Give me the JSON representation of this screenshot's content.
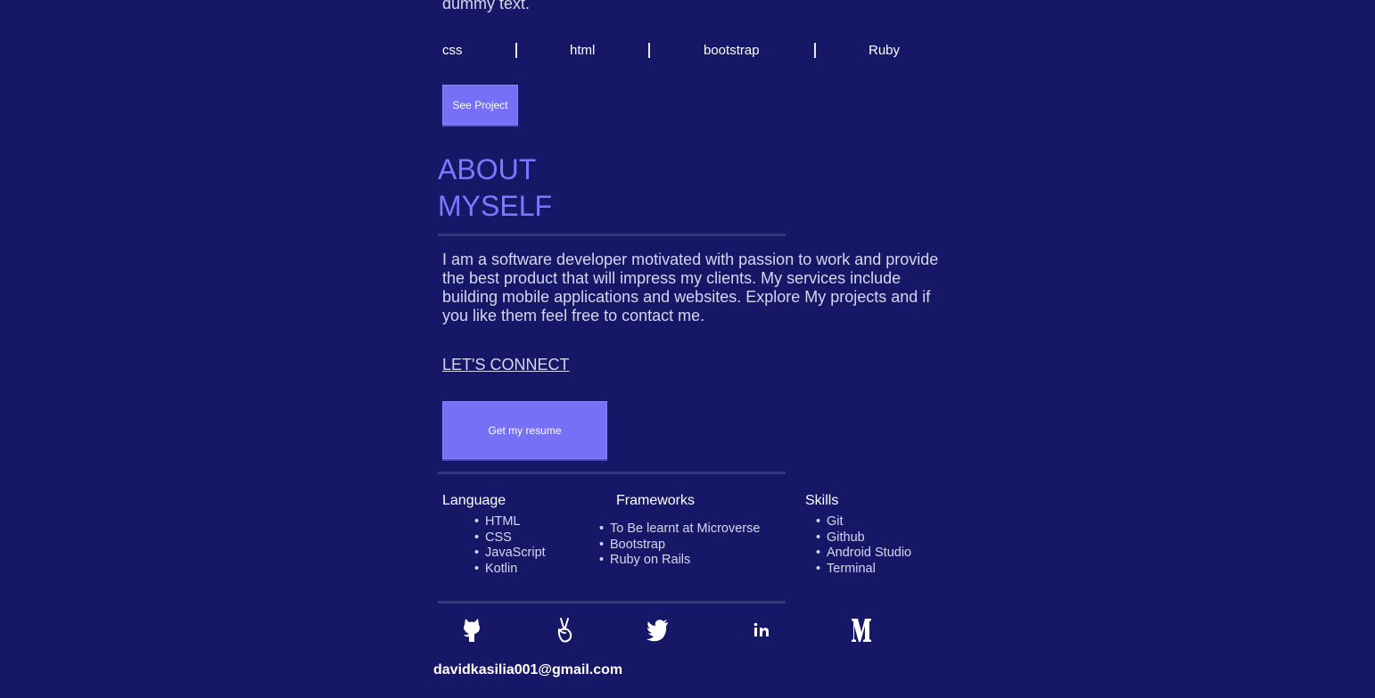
{
  "intro_tail": "dummy text.",
  "tags": [
    "css",
    "html",
    "bootstrap",
    "Ruby"
  ],
  "see_project_label": "See Project",
  "about": {
    "title_line1": "ABOUT",
    "title_line2": "MYSELF",
    "paragraph": "I am a software developer motivated with passion to work and provide the best product that will impress my clients. My services include building mobile applications and websites. Explore My projects and if you like them feel free to contact me."
  },
  "connect_label": "LET'S CONNECT",
  "resume_label": "Get my resume",
  "skills": {
    "language": {
      "title": "Language",
      "items": [
        "HTML",
        "CSS",
        "JavaScript",
        "Kotlin"
      ]
    },
    "frameworks": {
      "title": "Frameworks",
      "items": [
        "To Be learnt at Microverse",
        "Bootstrap",
        "Ruby on Rails"
      ]
    },
    "skills": {
      "title": "Skills",
      "items": [
        "Git",
        "Github",
        "Android Studio",
        "Terminal"
      ]
    }
  },
  "social": [
    "github-icon",
    "angellist-icon",
    "twitter-icon",
    "linkedin-icon",
    "medium-icon"
  ],
  "email": "davidkasilia001@gmail.com",
  "colors": {
    "background": "#161766",
    "accent": "#7570f6",
    "heading": "#7e78ff",
    "text": "#d6d6f0"
  }
}
